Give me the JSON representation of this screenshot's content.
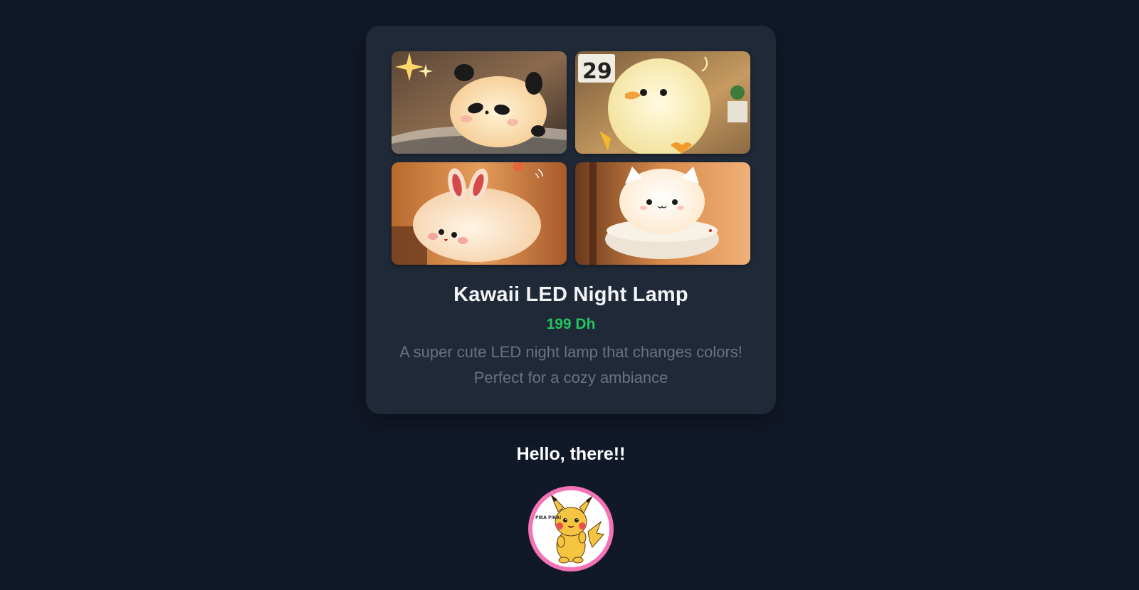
{
  "product": {
    "title": "Kawaii LED Night Lamp",
    "price": "199 Dh",
    "description": "A super cute LED night lamp that changes colors! Perfect for a cozy ambiance",
    "images": [
      {
        "subject": "panda-lamp"
      },
      {
        "subject": "duck-lamp"
      },
      {
        "subject": "bunny-lamp"
      },
      {
        "subject": "cat-lamp"
      }
    ]
  },
  "footer": {
    "greeting": "Hello, there!!",
    "avatar_caption": "PIKA PIKA!"
  },
  "colors": {
    "page_background": "#111827",
    "card_background": "#1f2937",
    "price": "#22c55e",
    "description": "#6b7280",
    "avatar_ring": "#f472b6"
  }
}
